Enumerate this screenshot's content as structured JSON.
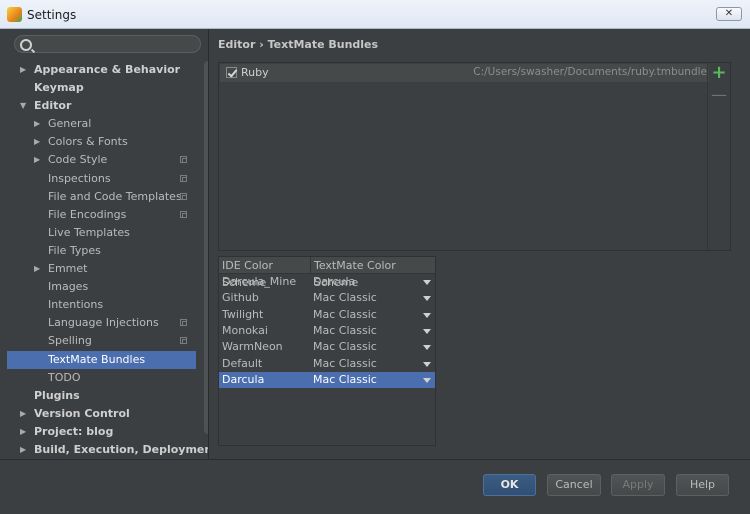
{
  "window": {
    "title": "Settings",
    "close_glyph": "✕"
  },
  "search": {
    "placeholder": "",
    "value": ""
  },
  "tree": [
    {
      "label": "Appearance & Behavior",
      "level": 0,
      "arrow": "▶",
      "bold": true,
      "project": false
    },
    {
      "label": "Keymap",
      "level": 0,
      "arrow": "",
      "bold": true,
      "project": false
    },
    {
      "label": "Editor",
      "level": 0,
      "arrow": "▼",
      "bold": true,
      "project": false
    },
    {
      "label": "General",
      "level": 1,
      "arrow": "▶",
      "bold": false,
      "project": false
    },
    {
      "label": "Colors & Fonts",
      "level": 1,
      "arrow": "▶",
      "bold": false,
      "project": false
    },
    {
      "label": "Code Style",
      "level": 1,
      "arrow": "▶",
      "bold": false,
      "project": true
    },
    {
      "label": "Inspections",
      "level": 1,
      "arrow": "",
      "bold": false,
      "project": true
    },
    {
      "label": "File and Code Templates",
      "level": 1,
      "arrow": "",
      "bold": false,
      "project": true
    },
    {
      "label": "File Encodings",
      "level": 1,
      "arrow": "",
      "bold": false,
      "project": true
    },
    {
      "label": "Live Templates",
      "level": 1,
      "arrow": "",
      "bold": false,
      "project": false
    },
    {
      "label": "File Types",
      "level": 1,
      "arrow": "",
      "bold": false,
      "project": false
    },
    {
      "label": "Emmet",
      "level": 1,
      "arrow": "▶",
      "bold": false,
      "project": false
    },
    {
      "label": "Images",
      "level": 1,
      "arrow": "",
      "bold": false,
      "project": false
    },
    {
      "label": "Intentions",
      "level": 1,
      "arrow": "",
      "bold": false,
      "project": false
    },
    {
      "label": "Language Injections",
      "level": 1,
      "arrow": "",
      "bold": false,
      "project": true
    },
    {
      "label": "Spelling",
      "level": 1,
      "arrow": "",
      "bold": false,
      "project": true
    },
    {
      "label": "TextMate Bundles",
      "level": 1,
      "arrow": "",
      "bold": false,
      "project": false,
      "selected": true
    },
    {
      "label": "TODO",
      "level": 1,
      "arrow": "",
      "bold": false,
      "project": false
    },
    {
      "label": "Plugins",
      "level": 0,
      "arrow": "",
      "bold": true,
      "project": false
    },
    {
      "label": "Version Control",
      "level": 0,
      "arrow": "▶",
      "bold": true,
      "project": false
    },
    {
      "label": "Project: blog",
      "level": 0,
      "arrow": "▶",
      "bold": true,
      "project": false
    },
    {
      "label": "Build, Execution, Deployment",
      "level": 0,
      "arrow": "▶",
      "bold": true,
      "project": false
    }
  ],
  "breadcrumb": "Editor › TextMate Bundles",
  "bundles": [
    {
      "name": "Ruby",
      "path": "C:/Users/swasher/Documents/ruby.tmbundle",
      "checked": true
    }
  ],
  "bundle_toolbar": {
    "add_glyph": "+",
    "remove_glyph": "—"
  },
  "scheme_table": {
    "headers": [
      "IDE Color Scheme",
      "TextMate Color Scheme"
    ],
    "rows": [
      {
        "ide": "Darcula_Mine",
        "textmate": "Darcula"
      },
      {
        "ide": "Github",
        "textmate": "Mac Classic"
      },
      {
        "ide": "Twilight",
        "textmate": "Mac Classic"
      },
      {
        "ide": "Monokai",
        "textmate": "Mac Classic"
      },
      {
        "ide": "WarmNeon",
        "textmate": "Mac Classic"
      },
      {
        "ide": "Default",
        "textmate": "Mac Classic"
      },
      {
        "ide": "Darcula",
        "textmate": "Mac Classic",
        "selected": true
      }
    ]
  },
  "buttons": {
    "ok": "OK",
    "cancel": "Cancel",
    "apply": "Apply",
    "help": "Help"
  },
  "colors": {
    "selection": "#4b6eaf",
    "background": "#3c3f41",
    "add": "#59b85a"
  }
}
